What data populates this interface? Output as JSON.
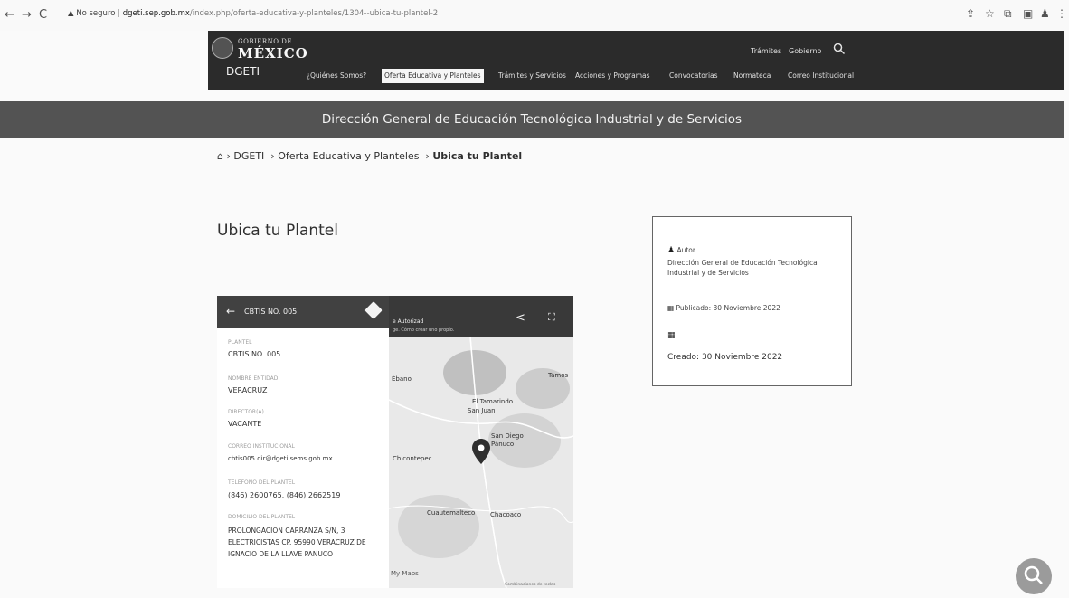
{
  "browser": {
    "back": "←",
    "forward": "→",
    "reload": "C",
    "warning": "▲ No seguro",
    "url_domain": "dgeti.sep.gob.mx",
    "url_path": "/index.php/oferta-educativa-y-planteles/1304--ubica-tu-plantel-2",
    "icons": [
      "share-icon",
      "star-icon",
      "extension-icon",
      "tab-icon",
      "profile-icon",
      "kebab-icon"
    ]
  },
  "header": {
    "logo_top": "GOBIERNO DE",
    "logo_main": "MÉXICO",
    "site_name": "DGETI",
    "top_links": [
      "Trámites",
      "Gobierno"
    ],
    "menu": [
      "¿Quiénes Somos?",
      "Oferta Educativa y Planteles",
      "Trámites y Servicios",
      "Acciones y Programas",
      "Convocatorias",
      "Normateca",
      "Correo Institucional"
    ],
    "active_menu": "Oferta Educativa y Planteles"
  },
  "banner": "Dirección General de Educación Tecnológica Industrial y de Servicios",
  "breadcrumb": {
    "items": [
      "DGETI",
      "Oferta Educativa y Planteles"
    ],
    "current": "Ubica tu Plantel"
  },
  "page_title": "Ubica tu Plantel",
  "info": {
    "author_label": "Autor",
    "author_name": "Dirección General de Educación Tecnológica Industrial y de Servicios",
    "published": "Publicado: 30 Noviembre 2022",
    "created": "Creado: 30 Noviembre 2022"
  },
  "map": {
    "panel_title": "CBTIS NO. 005",
    "header_text": "e Autorizad",
    "header_subtext": "ge. Cómo crear uno propio.",
    "fields": [
      {
        "label": "PLANTEL",
        "value": "CBTIS NO. 005"
      },
      {
        "label": "NOMBRE ENTIDAD",
        "value": "VERACRUZ"
      },
      {
        "label": "DIRECTOR(A)",
        "value": "VACANTE"
      },
      {
        "label": "CORREO INSTITUCIONAL",
        "value": "cbtis005.dir@dgeti.sems.gob.mx"
      },
      {
        "label": "TELÉFONO DEL PLANTEL",
        "value": "(846) 2600765, (846) 2662519"
      },
      {
        "label": "DOMICILIO DEL PLANTEL",
        "value": "PROLONGACION CARRANZA S/N, 3 ELECTRICISTAS CP. 95990 VERACRUZ DE IGNACIO DE LA LLAVE PANUCO"
      }
    ],
    "places": [
      "Ébano",
      "Tamos",
      "El Tamarindo",
      "San Juan",
      "San Diego",
      "Pánuco",
      "Chicontepec",
      "Cuautemalteco",
      "Chacoaco",
      "My Maps",
      "Combinaciones de teclas"
    ]
  }
}
